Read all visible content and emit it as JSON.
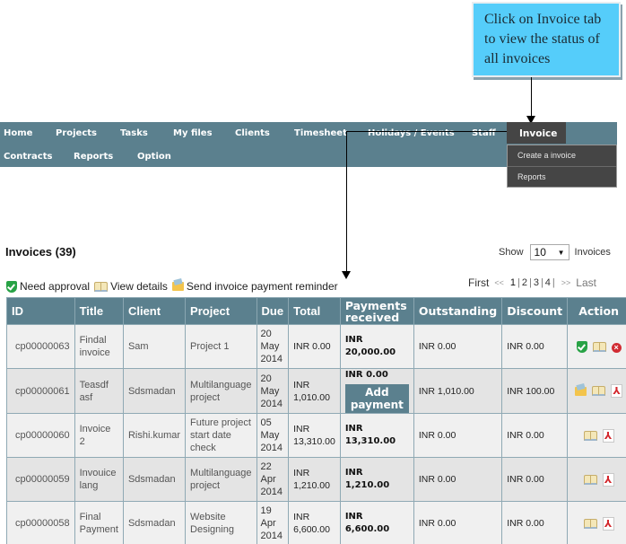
{
  "callout": {
    "text": "Click on Invoice tab to view the status of all invoices"
  },
  "nav": {
    "row1": [
      "Home",
      "Projects",
      "Tasks",
      "My files",
      "Clients",
      "Timesheet",
      "Holidays / Events",
      "Staff"
    ],
    "row2": [
      "Contracts",
      "Reports",
      "Option"
    ],
    "active": "Invoice",
    "dropdown": [
      "Create a invoice",
      "Reports"
    ]
  },
  "page": {
    "title": "Invoices (39)",
    "show_label": "Show",
    "show_value": "10",
    "show_suffix": "Invoices"
  },
  "legend": {
    "need_approval": "Need approval",
    "view_details": "View details",
    "send_reminder": "Send invoice payment reminder"
  },
  "pager": {
    "first": "First",
    "prev": "<<",
    "pages": [
      "1",
      "2",
      "3",
      "4"
    ],
    "current": "1",
    "next": ">>",
    "last": "Last"
  },
  "table": {
    "headers": [
      "ID",
      "Title",
      "Client",
      "Project",
      "Due",
      "Total",
      "Payments received",
      "Outstanding",
      "Discount",
      "Action"
    ],
    "add_payment_label": "Add payment",
    "rows": [
      {
        "id": "cp00000063",
        "title": "Findal invoice",
        "client": "Sam",
        "project": "Project 1",
        "due_day": "20",
        "due_month": "May",
        "due_year": "2014",
        "total": "INR 0.00",
        "paid": "INR 20,000.00",
        "outstanding": "INR 0.00",
        "discount": "INR 0.00",
        "actions": [
          "approve-icon",
          "view-details-icon",
          "delete-icon"
        ]
      },
      {
        "id": "cp00000061",
        "title": "Teasdf asf",
        "client": "Sdsmadan",
        "project": "Multilanguage project",
        "due_day": "20",
        "due_month": "May",
        "due_year": "2014",
        "total": "INR 1,010.00",
        "paid": "INR 0.00",
        "outstanding": "INR 1,010.00",
        "discount": "INR 100.00",
        "actions": [
          "send-reminder-icon",
          "view-details-icon",
          "pdf-icon"
        ]
      },
      {
        "id": "cp00000060",
        "title": "Invoice 2",
        "client": "Rishi.kumar",
        "project": "Future project start date check",
        "due_day": "05",
        "due_month": "May",
        "due_year": "2014",
        "total": "INR 13,310.00",
        "paid": "INR 13,310.00",
        "outstanding": "INR 0.00",
        "discount": "INR 0.00",
        "actions": [
          "view-details-icon",
          "pdf-icon"
        ]
      },
      {
        "id": "cp00000059",
        "title": "Invouice lang",
        "client": "Sdsmadan",
        "project": "Multilanguage project",
        "due_day": "22",
        "due_month": "Apr",
        "due_year": "2014",
        "total": "INR 1,210.00",
        "paid": "INR 1,210.00",
        "outstanding": "INR 0.00",
        "discount": "INR 0.00",
        "actions": [
          "view-details-icon",
          "pdf-icon"
        ]
      },
      {
        "id": "cp00000058",
        "title": "Final Payment",
        "client": "Sdsmadan",
        "project": "Website Designing",
        "due_day": "19",
        "due_month": "Apr",
        "due_year": "2014",
        "total": "INR 6,600.00",
        "paid": "INR 6,600.00",
        "outstanding": "INR 0.00",
        "discount": "INR 0.00",
        "actions": [
          "view-details-icon",
          "pdf-icon"
        ]
      }
    ]
  },
  "colors": {
    "nav_bg": "#5b808e",
    "nav_active_bg": "#454545",
    "callout_bg": "#55cdfa"
  }
}
